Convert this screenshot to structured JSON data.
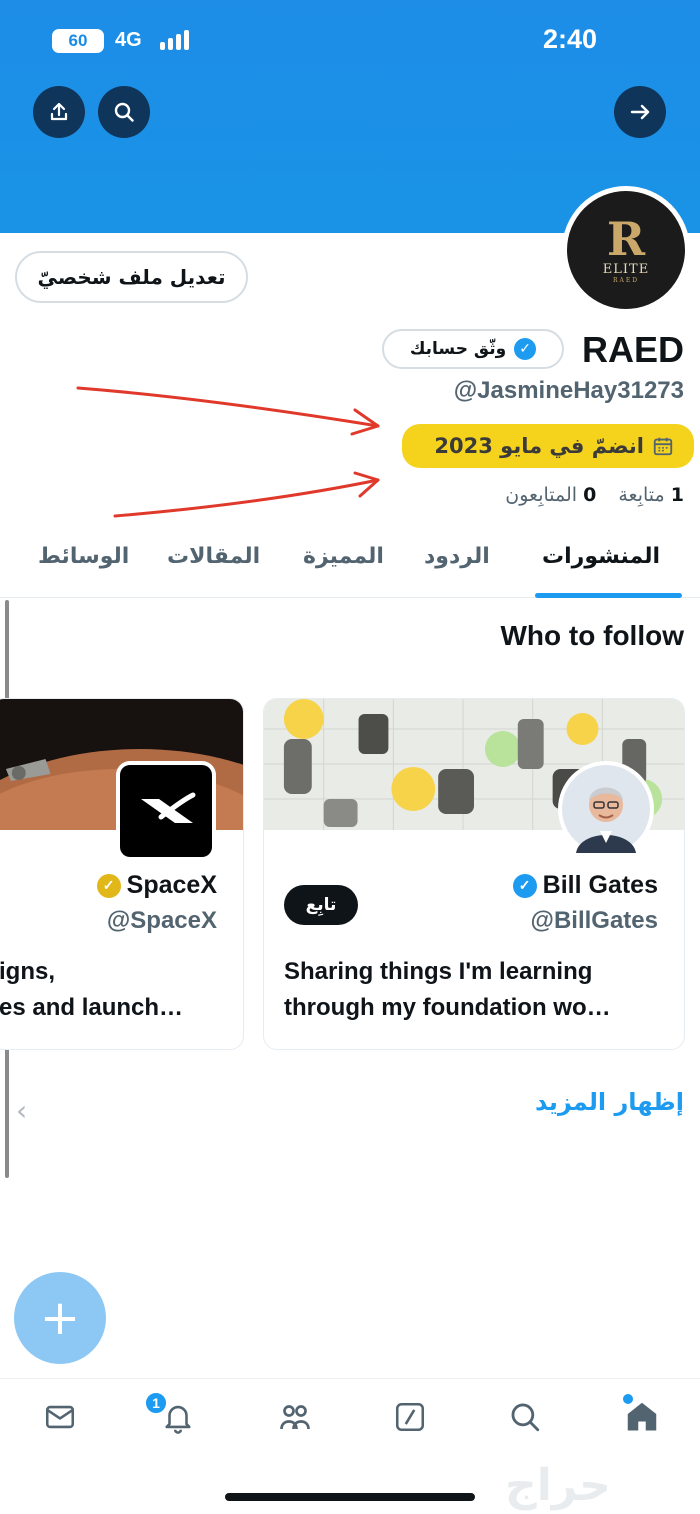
{
  "status_bar": {
    "time": "2:40",
    "battery": "60",
    "network": "4G"
  },
  "profile": {
    "avatar": {
      "letter": "R",
      "line1": "ELITE",
      "line2": "RAED"
    },
    "edit_label": "تعديل ملف شخصيّ",
    "name": "RAED",
    "verify_label": "وثّق حسابك",
    "handle": "@JasmineHay31273",
    "joined": "انضمّ في مايو 2023",
    "following_count": "1",
    "following_label": "متابِعة",
    "followers_count": "0",
    "followers_label": "المتابِعون"
  },
  "tabs": [
    "المنشورات",
    "الردود",
    "المميزة",
    "المقالات",
    "الوسائط"
  ],
  "who_to_follow": {
    "title": "Who to follow",
    "cards": [
      {
        "name": "Bill Gates",
        "handle": "@BillGates",
        "bio_line1": "Sharing things I'm learning",
        "bio_line2": "through my foundation wo…",
        "follow_label": "تابِع"
      },
      {
        "name": "SpaceX",
        "handle": "@SpaceX",
        "bio_line1": "igns,",
        "bio_line2": "es and launch…"
      }
    ],
    "show_more": "إظهار المزيد"
  },
  "bottom_nav": {
    "notification_count": "1"
  },
  "watermark": "حراج",
  "colors": {
    "accent": "#1d9bf0",
    "banner": "#1a93e6",
    "highlight": "#f5d21c",
    "annotation_arrow": "#e0392b"
  }
}
